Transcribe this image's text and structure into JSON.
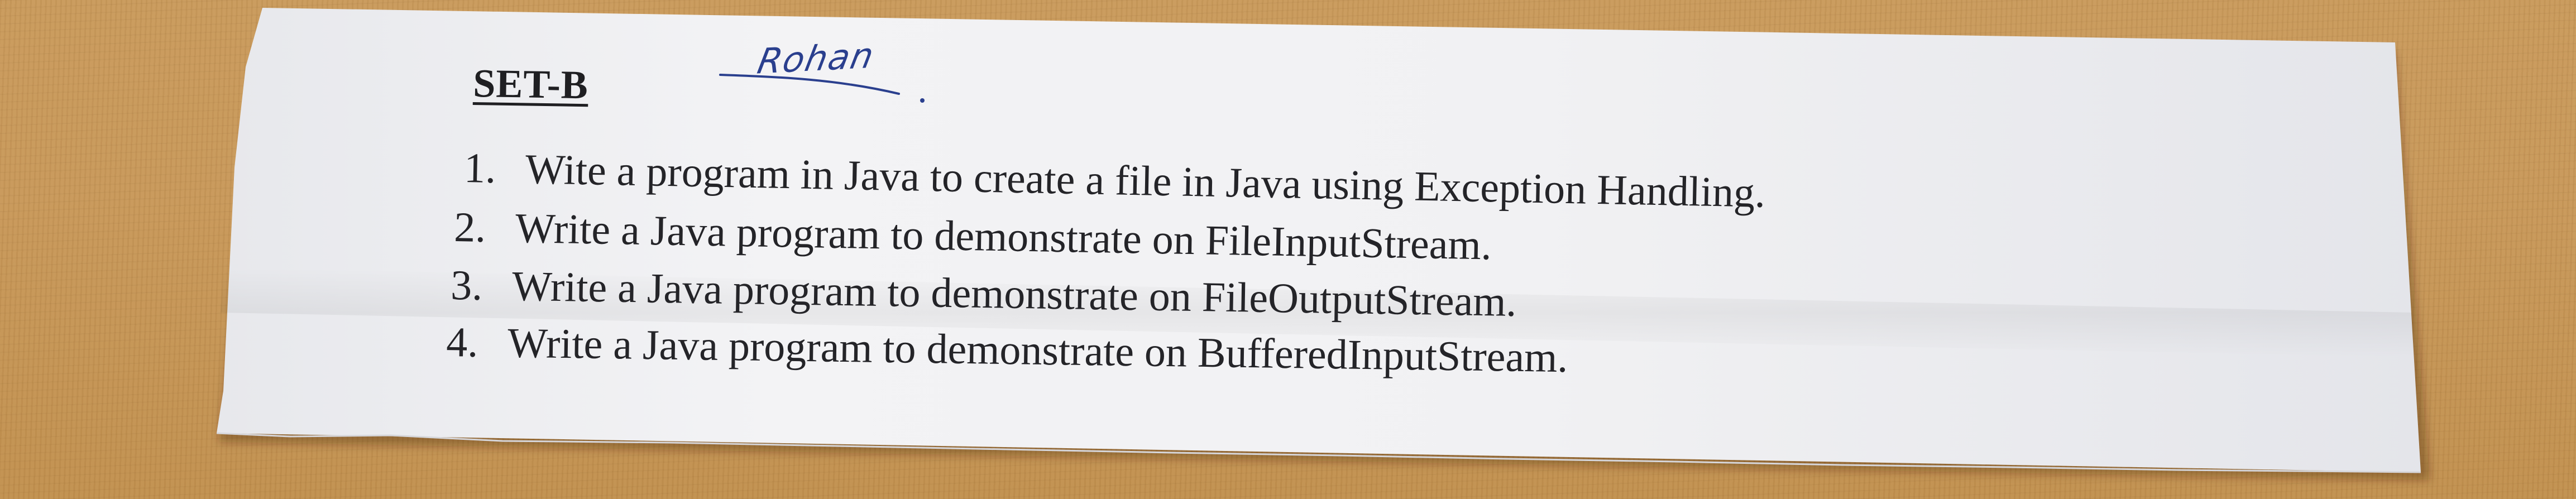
{
  "sheet": {
    "set_title": "SET-B",
    "signature": "Rohan",
    "tasks": [
      {
        "num": "1.",
        "text": "Wite a program in Java to create a file in Java using Exception Handling."
      },
      {
        "num": "2.",
        "text": "Write a Java program to demonstrate on FileInputStream."
      },
      {
        "num": "3.",
        "text": "Write a Java program to demonstrate on FileOutputStream."
      },
      {
        "num": "4.",
        "text": "Write a Java program to demonstrate on BufferedInputStream."
      }
    ]
  },
  "colors": {
    "table": "#c8985a",
    "paper": "#f1f1f3",
    "ink": "#242428",
    "pen": "#2a3f8e"
  }
}
